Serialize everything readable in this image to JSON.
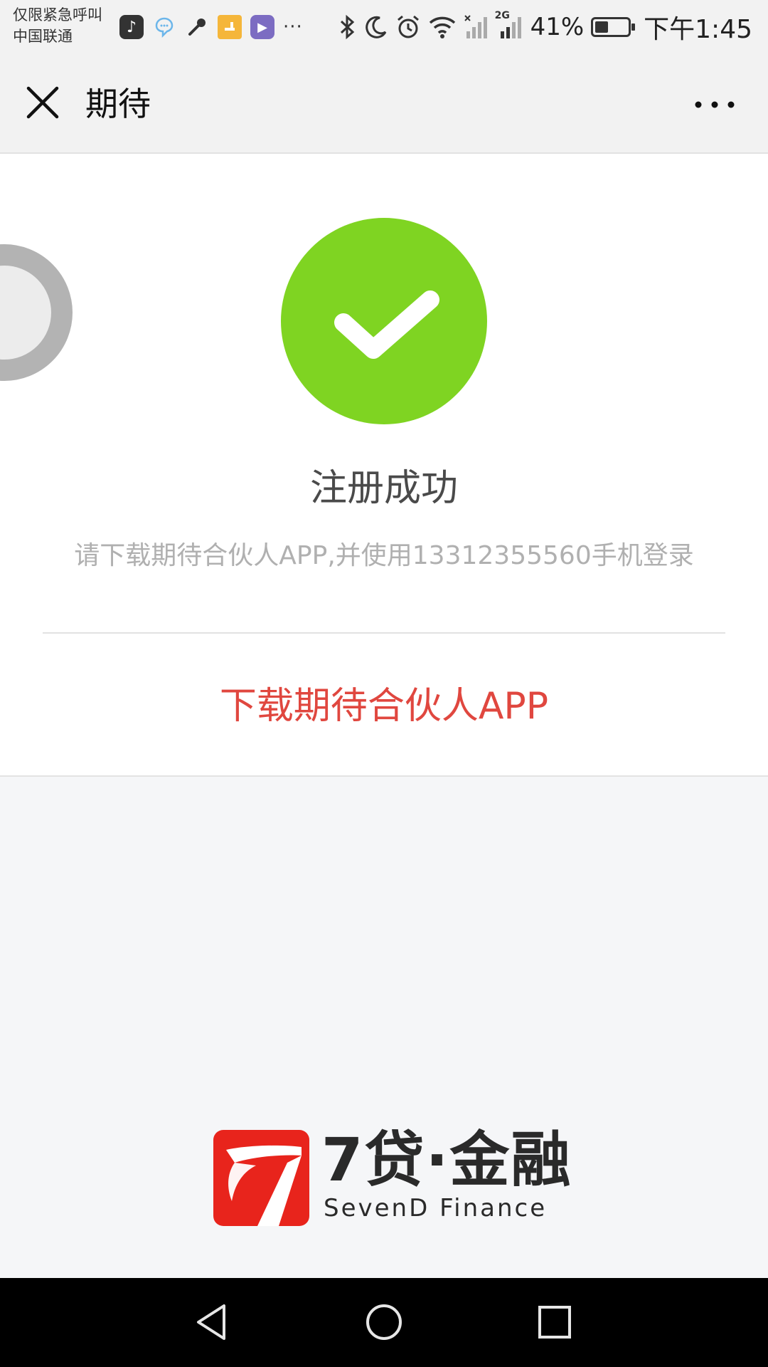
{
  "status_bar": {
    "carrier_line1": "仅限紧急呼叫",
    "carrier_line2": "中国联通",
    "notif_icons": [
      "tiktok-icon",
      "message-icon",
      "key-icon",
      "orange-app-icon",
      "video-app-icon",
      "more-dots-icon"
    ],
    "more_dots": "···",
    "network_label": "2G",
    "battery_percent": "41%",
    "battery_level": 0.41,
    "time": "下午1:45"
  },
  "nav": {
    "title": "期待"
  },
  "content": {
    "success_title": "注册成功",
    "success_desc": "请下载期待合伙人APP,并使用13312355560手机登录",
    "download_label": "下载期待合伙人APP"
  },
  "colors": {
    "success_green": "#7fd422",
    "link_red": "#e0473f",
    "logo_red": "#e8241c"
  },
  "logo": {
    "cn": "7贷·金融",
    "en": "SevenD Finance"
  }
}
